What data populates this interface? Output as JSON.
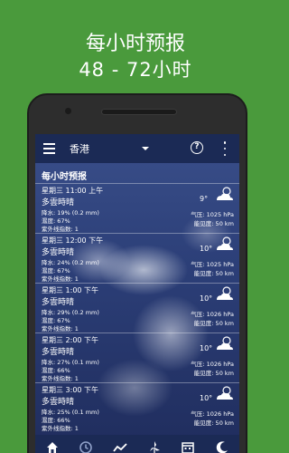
{
  "promo": {
    "title": "每小时预报",
    "subtitle": "48 - 72小时"
  },
  "appbar": {
    "location": "香港",
    "icons": [
      "menu-icon",
      "dropdown-icon",
      "help-icon",
      "more-icon"
    ]
  },
  "section_title": "每小时预报",
  "forecast": [
    {
      "time": "星期三 11:00 上午",
      "condition": "多雲時晴",
      "precip": "降水: 19% (0.2 mm)",
      "humidity": "濕度: 67%",
      "uv": "紫外线指数: 1",
      "temp": "9°",
      "pressure": "气压: 1025 hPa",
      "visibility": "能见度: 50 km",
      "icon": "partly-cloudy-icon"
    },
    {
      "time": "星期三 12:00 下午",
      "condition": "多雲時晴",
      "precip": "降水: 24% (0.2 mm)",
      "humidity": "濕度: 67%",
      "uv": "紫外线指数: 1",
      "temp": "10°",
      "pressure": "气压: 1025 hPa",
      "visibility": "能见度: 50 km",
      "icon": "partly-cloudy-icon"
    },
    {
      "time": "星期三 1:00 下午",
      "condition": "多雲時晴",
      "precip": "降水: 29% (0.2 mm)",
      "humidity": "濕度: 67%",
      "uv": "紫外线指数: 1",
      "temp": "10°",
      "pressure": "气压: 1026 hPa",
      "visibility": "能见度: 50 km",
      "icon": "partly-cloudy-icon"
    },
    {
      "time": "星期三 2:00 下午",
      "condition": "多雲時晴",
      "precip": "降水: 27% (0.1 mm)",
      "humidity": "濕度: 66%",
      "uv": "紫外线指数: 1",
      "temp": "10°",
      "pressure": "气压: 1026 hPa",
      "visibility": "能见度: 50 km",
      "icon": "partly-cloudy-icon"
    },
    {
      "time": "星期三 3:00 下午",
      "condition": "多雲時晴",
      "precip": "降水: 25% (0.1 mm)",
      "humidity": "濕度: 66%",
      "uv": "紫外线指数: 1",
      "temp": "10°",
      "pressure": "气压: 1026 hPa",
      "visibility": "能见度: 50 km",
      "icon": "partly-cloudy-icon"
    }
  ],
  "bottom_nav": [
    "home-icon",
    "clock-icon",
    "chart-icon",
    "wind-icon",
    "calendar-icon",
    "moon-icon"
  ],
  "colors": {
    "background": "#4a9a3c",
    "appbar": "#1b2a55",
    "active_nav": "#8fa0c8"
  }
}
